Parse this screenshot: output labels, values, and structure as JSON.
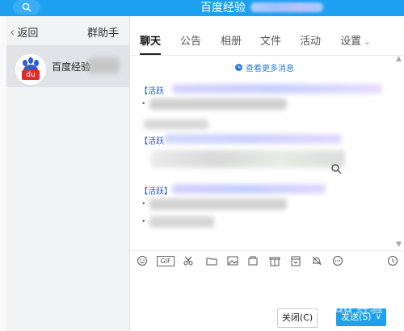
{
  "window": {
    "title": "百度经验"
  },
  "sidebar": {
    "back_label": "返回",
    "back_chevron": "‹",
    "group_helper": "群助手",
    "group_item": {
      "name": "百度经验",
      "avatar_text": "du"
    }
  },
  "tabs": [
    {
      "label": "聊天",
      "active": true
    },
    {
      "label": "公告",
      "active": false
    },
    {
      "label": "相册",
      "active": false
    },
    {
      "label": "文件",
      "active": false
    },
    {
      "label": "活动",
      "active": false
    },
    {
      "label": "设置",
      "active": false
    }
  ],
  "chat": {
    "more_messages": "查看更多消息",
    "messages": [
      {
        "tag": "【活跃"
      },
      {
        "tag": "【活跃"
      },
      {
        "tag": "【活跃】"
      }
    ]
  },
  "toolbar": {
    "icons": [
      "smile-icon",
      "gif-icon",
      "scissors-icon",
      "folder-icon",
      "image-icon",
      "screenshot-icon",
      "gift-icon",
      "calendar-icon",
      "bell-icon",
      "more-icon",
      "history-icon"
    ],
    "gif_label": "GIF"
  },
  "buttons": {
    "close_label": "关闭(C)",
    "send_label": "发送(S)",
    "send_caret": "∨"
  },
  "watermark": "Baidu 经验",
  "colors": {
    "accent": "#1ea0f0",
    "tag": "#1a56c9",
    "sidebar_bg": "#f2f3f5"
  }
}
